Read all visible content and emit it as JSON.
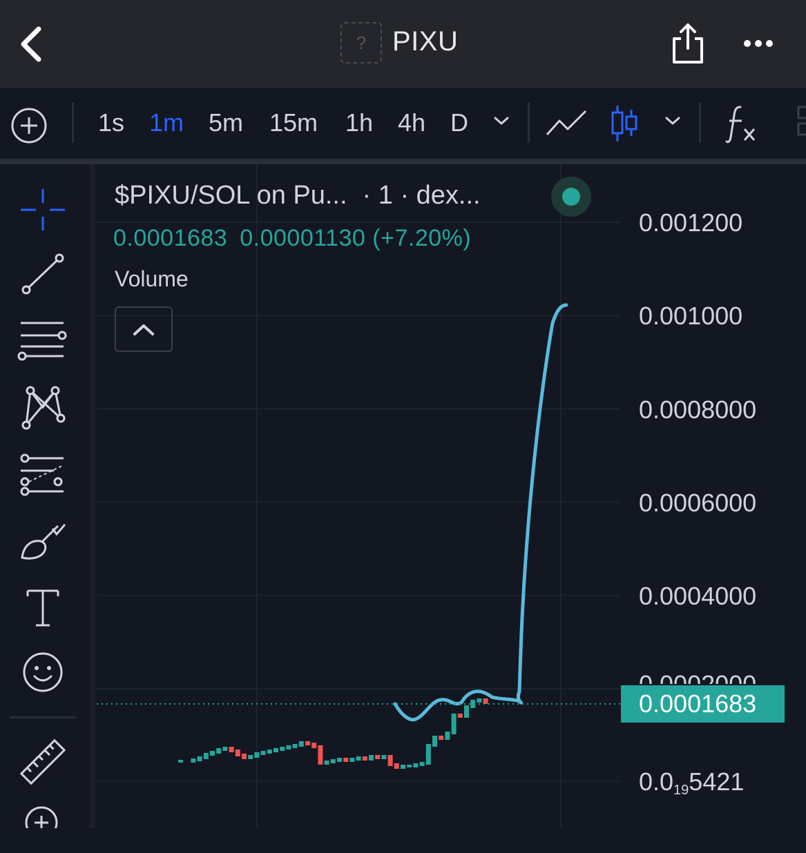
{
  "header": {
    "title": "PIXU",
    "token_logo_placeholder": "?"
  },
  "toolbar": {
    "intervals": [
      {
        "label": "1s",
        "active": false
      },
      {
        "label": "1m",
        "active": true
      },
      {
        "label": "5m",
        "active": false
      },
      {
        "label": "15m",
        "active": false
      },
      {
        "label": "1h",
        "active": false
      },
      {
        "label": "4h",
        "active": false
      },
      {
        "label": "D",
        "active": false
      }
    ],
    "active_color": "#2962ff"
  },
  "sidebar": {
    "tools": [
      "crosshair-icon",
      "trend-line-icon",
      "horizontal-lines-icon",
      "pattern-icon",
      "fib-icon",
      "brush-icon",
      "text-icon",
      "emoji-icon",
      "ruler-icon",
      "zoom-in-icon"
    ]
  },
  "legend": {
    "symbol": "$PIXU/SOL on Pu...",
    "interval_info": "· 1 · dex...",
    "ohlc_close": "0.0001683",
    "ohlc_change": "0.00001130 (+7.20%)",
    "volume_label": "Volume"
  },
  "price_scale": {
    "labels": [
      "0.001200",
      "0.001000",
      "0.0008000",
      "0.0006000",
      "0.0004000",
      "0.0002000"
    ],
    "bottom_label_prefix": "0.0",
    "bottom_label_subscript": "19",
    "bottom_label_suffix": "5421",
    "last_price": "0.0001683",
    "last_price_color": "#26a69a"
  },
  "colors": {
    "up": "#26a69a",
    "down": "#ef5350",
    "drawn_line": "#5ab9d9",
    "background": "#131722"
  },
  "chart_data": {
    "type": "candlestick",
    "y_ticks": [
      0.0012,
      0.001,
      0.0008,
      0.0006,
      0.0004,
      0.0002
    ],
    "ylim": [
      5.421e-08,
      0.00127
    ],
    "last_price": 0.0001683,
    "change": 1.13e-05,
    "change_percent": 7.2
  }
}
